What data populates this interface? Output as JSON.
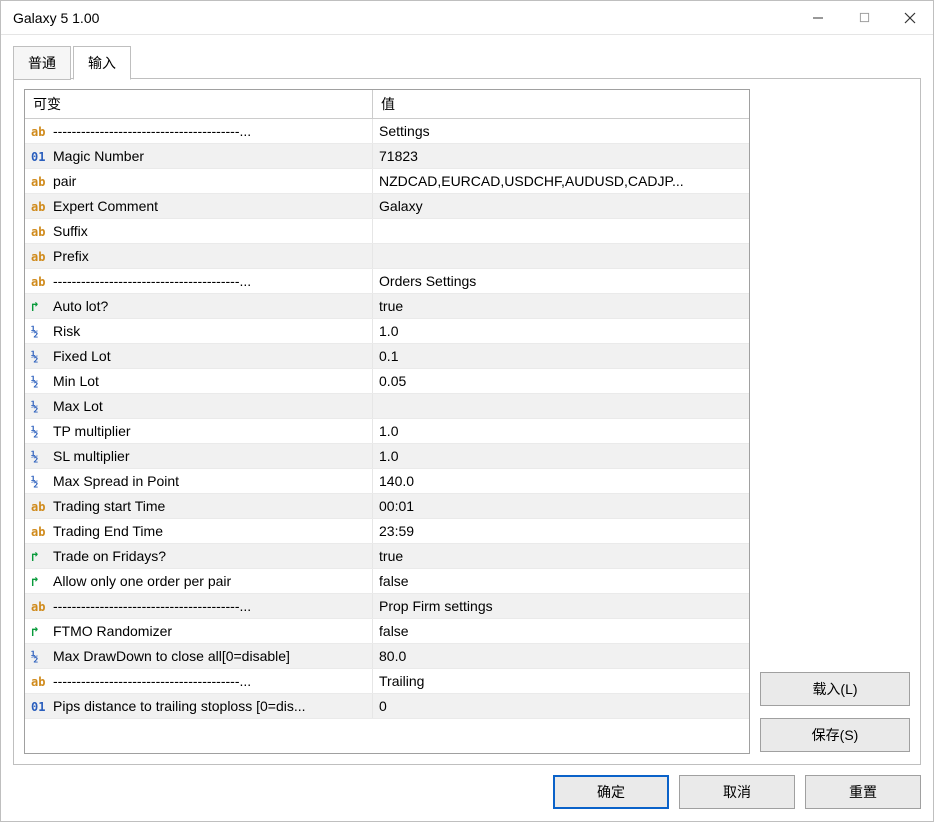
{
  "window": {
    "title": "Galaxy 5 1.00"
  },
  "tabs": {
    "general": "普通",
    "inputs": "输入"
  },
  "columns": {
    "variable": "可变",
    "value": "值"
  },
  "rows": [
    {
      "type": "ab",
      "name": "----------------------------------------...",
      "value": "Settings"
    },
    {
      "type": "01",
      "name": "Magic Number",
      "value": "71823"
    },
    {
      "type": "ab",
      "name": "pair",
      "value": "NZDCAD,EURCAD,USDCHF,AUDUSD,CADJP..."
    },
    {
      "type": "ab",
      "name": "Expert Comment",
      "value": "Galaxy"
    },
    {
      "type": "ab",
      "name": "Suffix",
      "value": ""
    },
    {
      "type": "ab",
      "name": "Prefix",
      "value": ""
    },
    {
      "type": "ab",
      "name": "----------------------------------------...",
      "value": "Orders Settings"
    },
    {
      "type": "bool",
      "name": "Auto lot?",
      "value": "true"
    },
    {
      "type": "half",
      "name": "Risk",
      "value": "1.0"
    },
    {
      "type": "half",
      "name": "Fixed Lot",
      "value": "0.1"
    },
    {
      "type": "half",
      "name": "Min Lot",
      "value": "0.05"
    },
    {
      "type": "half",
      "name": "Max Lot",
      "value": ""
    },
    {
      "type": "half",
      "name": "TP multiplier",
      "value": "1.0"
    },
    {
      "type": "half",
      "name": "SL multiplier",
      "value": "1.0"
    },
    {
      "type": "half",
      "name": "Max Spread in Point",
      "value": "140.0"
    },
    {
      "type": "ab",
      "name": "Trading start Time",
      "value": "00:01"
    },
    {
      "type": "ab",
      "name": "Trading End Time",
      "value": "23:59"
    },
    {
      "type": "bool",
      "name": "Trade on Fridays?",
      "value": "true"
    },
    {
      "type": "bool",
      "name": "Allow only one order per pair",
      "value": "false"
    },
    {
      "type": "ab",
      "name": "----------------------------------------...",
      "value": "Prop Firm settings"
    },
    {
      "type": "bool",
      "name": "FTMO Randomizer",
      "value": "false"
    },
    {
      "type": "half",
      "name": "Max DrawDown to close all[0=disable]",
      "value": "80.0"
    },
    {
      "type": "ab",
      "name": "----------------------------------------...",
      "value": "Trailing"
    },
    {
      "type": "01",
      "name": "Pips distance to trailing stoploss [0=dis...",
      "value": "0"
    }
  ],
  "side": {
    "load": "载入(L)",
    "save": "保存(S)"
  },
  "footer": {
    "ok": "确定",
    "cancel": "取消",
    "reset": "重置"
  }
}
